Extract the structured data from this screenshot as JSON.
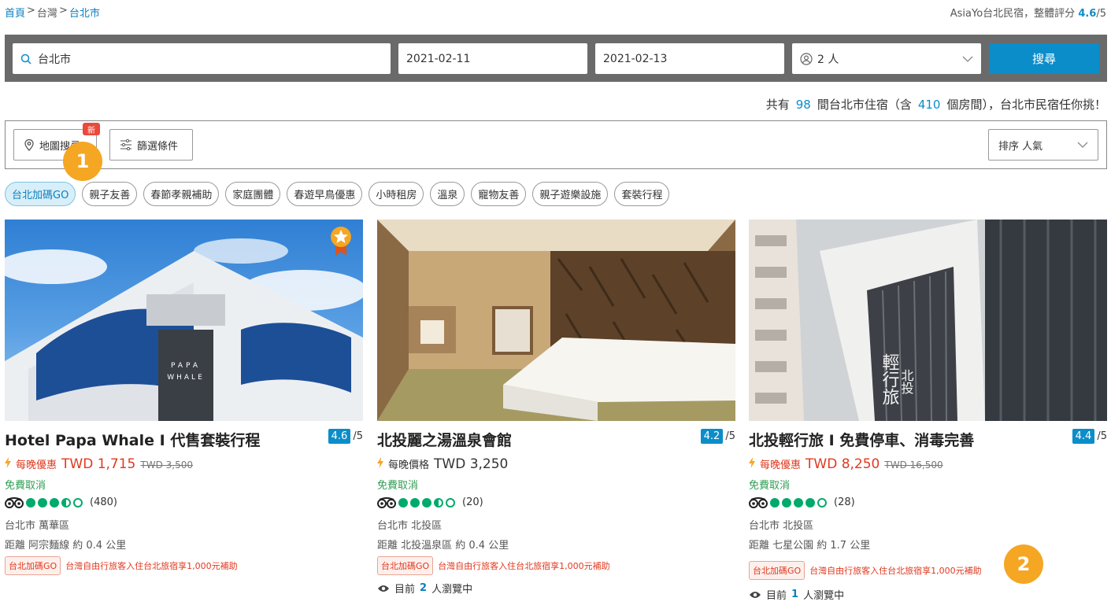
{
  "breadcrumb": {
    "home": "首頁",
    "sep1": ">",
    "country": "台灣",
    "sep2": ">",
    "city": "台北市"
  },
  "site_rating": {
    "text": "AsiaYo台北民宿，整體評分",
    "score": "4.6",
    "max": "/5"
  },
  "search": {
    "location": "台北市",
    "checkin": "2021-02-11",
    "checkout": "2021-02-13",
    "guests": "2 人",
    "button": "搜尋"
  },
  "summary": {
    "prefix": "共有",
    "count": "98",
    "mid": "間台北市住宿（含",
    "rooms": "410",
    "suffix": "個房間），台北市民宿任你挑！"
  },
  "filters": {
    "map": "地圖搜尋",
    "new_badge": "新",
    "filter": "篩選條件",
    "sort": "排序 人氣"
  },
  "markers": {
    "m1": "1",
    "m2": "2"
  },
  "tags": [
    "台北加碼GO",
    "親子友善",
    "春節孝親補助",
    "家庭團體",
    "春遊早鳥優惠",
    "小時租房",
    "溫泉",
    "寵物友善",
    "親子遊樂設施",
    "套裝行程"
  ],
  "hotels": [
    {
      "name": "Hotel Papa Whale I 代售套裝行程",
      "score": "4.6",
      "max": "/5",
      "price_label": "每晚優惠",
      "price": "TWD 1,715",
      "orig_price": "TWD 3,500",
      "cancel": "免費取消",
      "reviews": "(480)",
      "rating": 3.5,
      "area": "台北市 萬華區",
      "distance": "距離 阿宗麵線 約 0.4 公里",
      "promo_tag": "台北加碼GO",
      "promo_text": "台灣自由行旅客入住台北旅宿享1,000元補助",
      "viewers_pre": "",
      "viewers_n": "",
      "viewers_post": ""
    },
    {
      "name": "北投麗之湯溫泉會館",
      "score": "4.2",
      "max": "/5",
      "price_label": "每晚價格",
      "price": "TWD 3,250",
      "orig_price": "",
      "cancel": "免費取消",
      "reviews": "(20)",
      "rating": 3.5,
      "area": "台北市 北投區",
      "distance": "距離 北投溫泉區 約 0.4 公里",
      "promo_tag": "台北加碼GO",
      "promo_text": "台灣自由行旅客入住台北旅宿享1,000元補助",
      "viewers_pre": "目前",
      "viewers_n": "2",
      "viewers_post": "人瀏覽中"
    },
    {
      "name": "北投輕行旅 I 免費停車、消毒完善",
      "score": "4.4",
      "max": "/5",
      "price_label": "每晚優惠",
      "price": "TWD 8,250",
      "orig_price": "TWD 16,500",
      "cancel": "免費取消",
      "reviews": "(28)",
      "rating": 4,
      "area": "台北市 北投區",
      "distance": "距離 七星公園 約 1.7 公里",
      "promo_tag": "台北加碼GO",
      "promo_text": "台灣自由行旅客入住台北旅宿享1,000元補助",
      "viewers_pre": "目前",
      "viewers_n": "1",
      "viewers_post": "人瀏覽中"
    }
  ],
  "building_text": {
    "papa": "PAPA",
    "whale": "WHALE",
    "sign1": "輕行旅",
    "sign2": "北投"
  }
}
